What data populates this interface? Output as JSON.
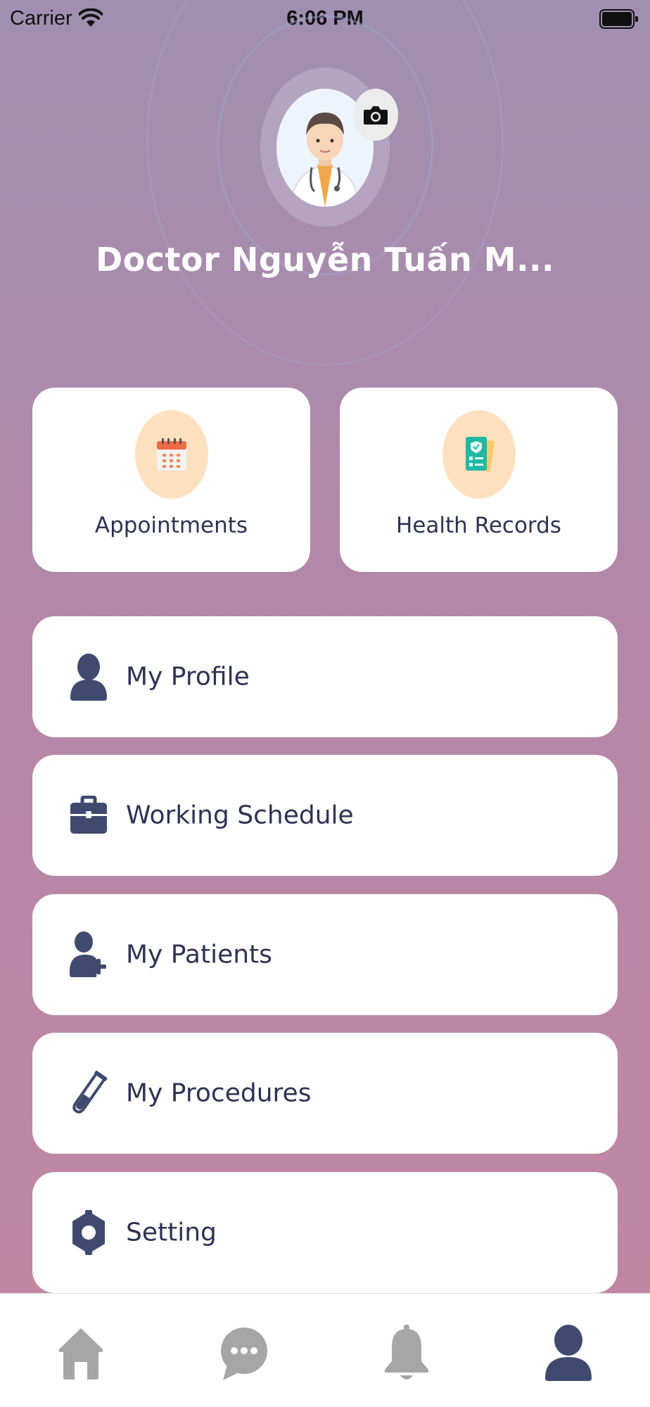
{
  "status_bar": {
    "carrier": "Carrier",
    "time": "6:06 PM"
  },
  "profile": {
    "doctor_name": "Doctor Nguyễn Tuấn M..."
  },
  "quick_actions": [
    {
      "label": "Appointments",
      "icon": "calendar-icon"
    },
    {
      "label": "Health Records",
      "icon": "health-records-icon"
    }
  ],
  "menu": [
    {
      "label": "My Profile",
      "icon": "user-icon"
    },
    {
      "label": "Working Schedule",
      "icon": "briefcase-icon"
    },
    {
      "label": "My Patients",
      "icon": "add-user-icon"
    },
    {
      "label": "My Procedures",
      "icon": "test-tube-icon"
    },
    {
      "label": "Setting",
      "icon": "gear-icon"
    }
  ],
  "tab_bar": [
    {
      "icon": "home-icon",
      "active": false
    },
    {
      "icon": "chat-icon",
      "active": false
    },
    {
      "icon": "bell-icon",
      "active": false
    },
    {
      "icon": "user-icon",
      "active": true
    }
  ],
  "colors": {
    "accent_dark": "#3f4a6e",
    "inactive_tab": "#a6a6a6",
    "icon_circle": "#fde1bf",
    "background_top": "#a08fb0",
    "background_bottom": "#c287a2"
  }
}
